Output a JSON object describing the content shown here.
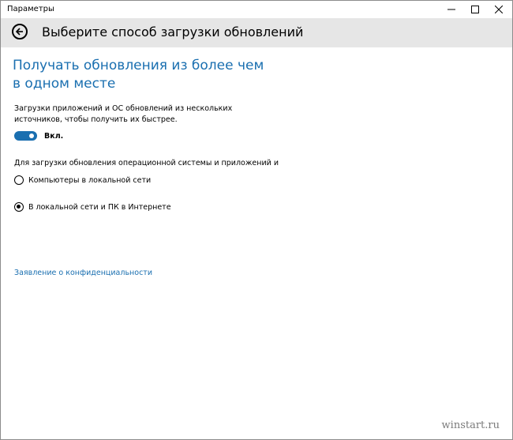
{
  "window": {
    "title": "Параметры"
  },
  "header": {
    "title": "Выберите способ загрузки обновлений"
  },
  "section": {
    "title": "Получать обновления из более чем в одном месте",
    "description": "Загрузки приложений и ОС обновлений из нескольких источников, чтобы получить их быстрее.",
    "toggle_state_label": "Вкл.",
    "toggle_on": true,
    "group_label": "Для загрузки обновления операционной системы и приложений и",
    "options": [
      {
        "label": "Компьютеры в локальной сети",
        "selected": false
      },
      {
        "label": "В локальной сети и ПК в Интернете",
        "selected": true
      }
    ]
  },
  "links": {
    "privacy": "Заявление о конфиденциальности"
  },
  "watermark": "winstart.ru",
  "colors": {
    "accent": "#1a6fb0",
    "header_bg": "#e6e6e6"
  }
}
